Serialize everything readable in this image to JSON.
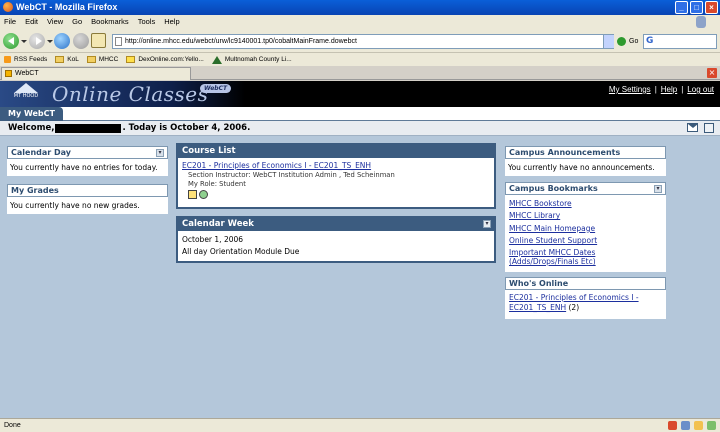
{
  "window": {
    "title": "WebCT - Mozilla Firefox"
  },
  "menu": [
    "File",
    "Edit",
    "View",
    "Go",
    "Bookmarks",
    "Tools",
    "Help"
  ],
  "nav": {
    "url": "http://online.mhcc.edu/webct/urw/lc9140001.tp0/cobaltMainFrame.dowebct",
    "go_label": "Go"
  },
  "bookmarks": [
    "RSS Feeds",
    "KoL",
    "MHCC",
    "DexOnline.com:Yello...",
    "Multnomah County Li..."
  ],
  "tab": {
    "title": "WebCT"
  },
  "banner": {
    "logo_text": "MT HOOD",
    "title": "Online Classes",
    "badge": "WebCT",
    "links": [
      "My Settings",
      "Help",
      "Log out"
    ],
    "separator": "|"
  },
  "mywebct_tab": "My WebCT",
  "welcome": {
    "prefix": "Welcome,",
    "suffix": ". Today is October 4, 2006."
  },
  "calendar_day": {
    "title": "Calendar Day",
    "message": "You currently have no entries for today."
  },
  "my_grades": {
    "title": "My Grades",
    "message": "You currently have no new grades."
  },
  "course_list": {
    "title": "Course List",
    "course_link": "EC201 - Principles of Economics I - EC201_TS_ENH",
    "instructor": "Section Instructor: WebCT Institution Admin , Ted Scheinman",
    "role": "My Role: Student"
  },
  "calendar_week": {
    "title": "Calendar Week",
    "date": "October 1, 2006",
    "event": "All day Orientation Module Due"
  },
  "announcements": {
    "title": "Campus Announcements",
    "message": "You currently have no announcements."
  },
  "campus_bookmarks": {
    "title": "Campus Bookmarks",
    "links": [
      "MHCC Bookstore",
      "MHCC Library",
      "MHCC Main Homepage",
      "Online Student Support",
      "Important MHCC Dates",
      "(Adds/Drops/Finals Etc)"
    ]
  },
  "whos_online": {
    "title": "Who's Online",
    "link_line1": "EC201 - Principles of Economics I -",
    "link_line2": "EC201_TS_ENH",
    "count": " (2)"
  },
  "statusbar": {
    "text": "Done"
  },
  "icons": {
    "collapse": "collapse-icon",
    "mail": "mail-icon",
    "settings": "settings-icon"
  },
  "colors": {
    "page_bg": "#b4c7da",
    "dark_header": "#3c5c80",
    "link": "#1c2f9e"
  }
}
